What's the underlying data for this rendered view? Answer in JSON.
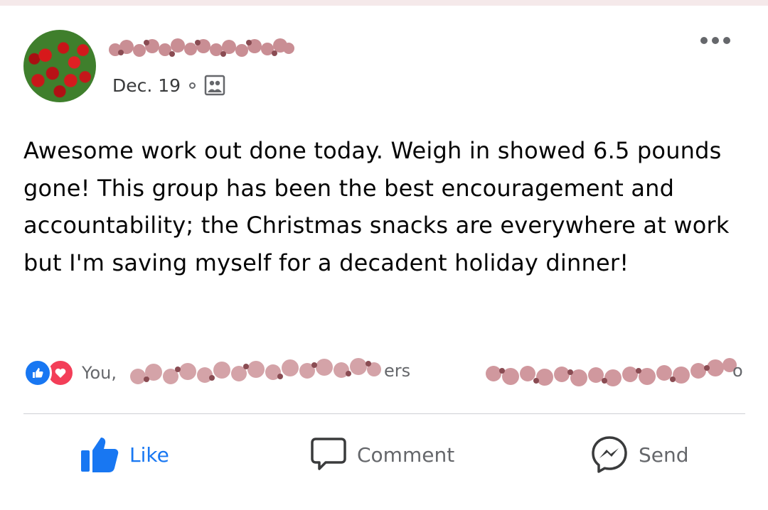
{
  "post": {
    "author_name": "",
    "date": "Dec. 19",
    "audience_icon": "group-icon",
    "text": "Awesome work out done today. Weigh in showed 6.5 pounds gone! This group has been the best encouragement and accountability; the Christmas snacks are everywhere at work but I'm saving myself for a decadent holiday dinner!",
    "reactions": {
      "icons": [
        "like-reaction-icon",
        "love-reaction-icon"
      ],
      "summary_prefix": "You,",
      "summary_suffix": "ers",
      "counts_suffix": "o"
    }
  },
  "actions": {
    "like": "Like",
    "comment": "Comment",
    "send": "Send"
  },
  "colors": {
    "accent": "#1877f2",
    "love": "#f33e58",
    "secondary_text": "#65676b",
    "redaction": "#c98e94"
  }
}
